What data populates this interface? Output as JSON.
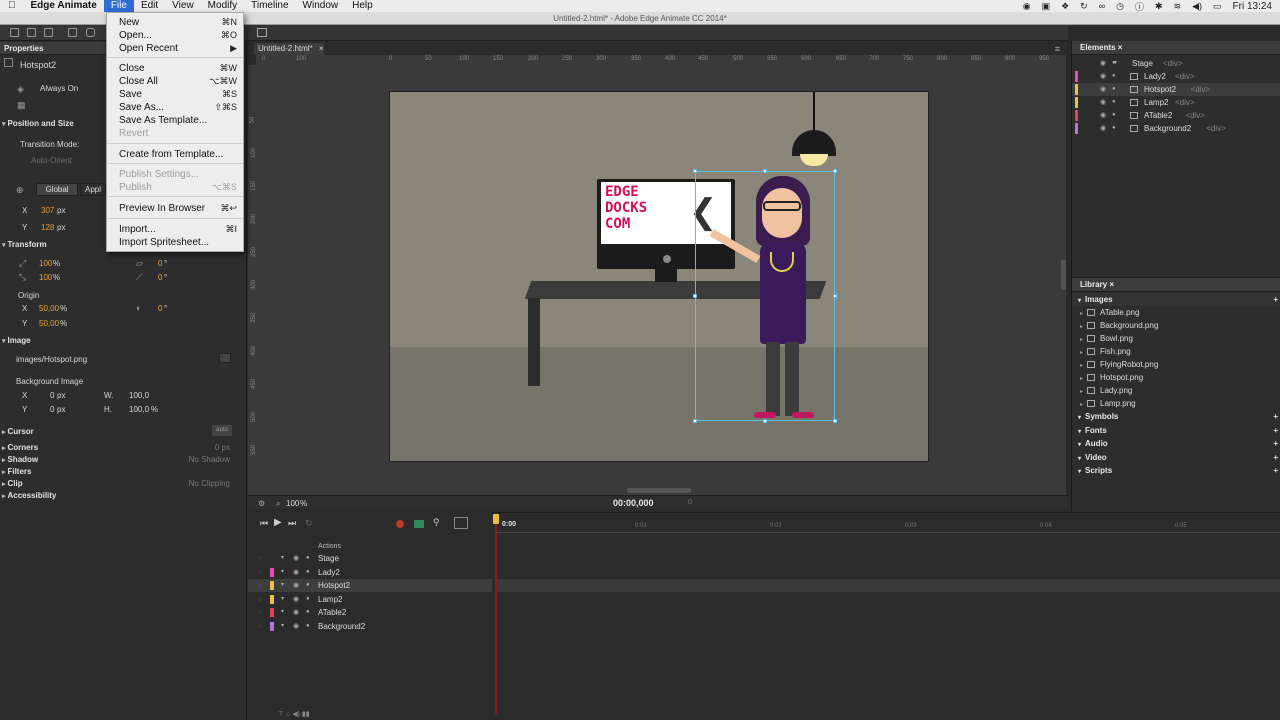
{
  "menubar": {
    "apple": "",
    "app": "Edge Animate",
    "items": [
      "File",
      "Edit",
      "View",
      "Modify",
      "Timeline",
      "Window",
      "Help"
    ],
    "clock": "Fri 13:24"
  },
  "window_title": "Untitled-2.html* - Adobe Edge Animate CC 2014*",
  "file_menu": {
    "items": [
      {
        "label": "New",
        "shortcut": "⌘N",
        "disabled": false
      },
      {
        "label": "Open...",
        "shortcut": "⌘O",
        "disabled": false
      },
      {
        "label": "Open Recent",
        "shortcut": "▶",
        "disabled": false
      },
      {
        "label": "Close",
        "shortcut": "⌘W",
        "disabled": false
      },
      {
        "label": "Close All",
        "shortcut": "⌥⌘W",
        "disabled": false
      },
      {
        "label": "Save",
        "shortcut": "⌘S",
        "disabled": false
      },
      {
        "label": "Save As...",
        "shortcut": "⇧⌘S",
        "disabled": false
      },
      {
        "label": "Save As Template...",
        "shortcut": "",
        "disabled": false
      },
      {
        "label": "Revert",
        "shortcut": "",
        "disabled": true
      },
      {
        "label": "Create from Template...",
        "shortcut": "",
        "disabled": false
      },
      {
        "label": "Publish Settings...",
        "shortcut": "",
        "disabled": true
      },
      {
        "label": "Publish",
        "shortcut": "⌥⌘S",
        "disabled": true
      },
      {
        "label": "Preview In Browser",
        "shortcut": "⌘↩",
        "disabled": false
      },
      {
        "label": "Import...",
        "shortcut": "⌘I",
        "disabled": false
      },
      {
        "label": "Import Spritesheet...",
        "shortcut": "",
        "disabled": false
      }
    ]
  },
  "properties": {
    "tab": "Properties",
    "element_name": "Hotspot2",
    "always_on": "Always On",
    "position_size": "Position and Size",
    "transition_mode": "Transition Mode:",
    "auto_orient": "Auto-Orient",
    "global": "Global",
    "applied": "Appl",
    "x_label": "X",
    "x_val": "307",
    "y_label": "Y",
    "y_val": "128",
    "px": "px",
    "transform": "Transform",
    "scale_x": "100",
    "scale_y": "100",
    "percent": "%",
    "skew_a": "0",
    "skew_b": "0",
    "deg": "°",
    "origin": "Origin",
    "origin_x": "50,00",
    "origin_y": "50,00",
    "rotate": "0",
    "image": "Image",
    "image_path": "images/Hotspot.png",
    "bg_image": "Background Image",
    "bg_x": "0",
    "bg_y": "0",
    "w_label": "W.",
    "h_label": "H.",
    "bg_w": "100,0",
    "bg_h": "100,0",
    "cursor": "Cursor",
    "cursor_val": "auto",
    "corners": "Corners",
    "corners_val": "0 px",
    "shadow": "Shadow",
    "shadow_val": "No Shadow",
    "filters": "Filters",
    "clip": "Clip",
    "clip_val": "No Clipping",
    "accessibility": "Accessibility"
  },
  "stage": {
    "tab": "Untitled-2.html*",
    "ruler_ticks": [
      "0",
      "100",
      "0",
      "50",
      "100",
      "150",
      "200",
      "250",
      "300",
      "350",
      "400",
      "450",
      "500",
      "550",
      "600",
      "650",
      "700",
      "750",
      "800",
      "850",
      "900",
      "950"
    ],
    "vruler_ticks": [
      "50",
      "100",
      "150",
      "200",
      "250",
      "300",
      "350",
      "400",
      "450",
      "500",
      "550"
    ],
    "zoom": "100",
    "timecode": "00:00,000",
    "frame": "0",
    "sign_text": [
      "EDGE",
      "DOCKS",
      "COM"
    ]
  },
  "elements": {
    "tab": "Elements",
    "rows": [
      {
        "name": "Stage",
        "tag": "<div>",
        "color": "",
        "indent": 0,
        "selected": false
      },
      {
        "name": "Lady2",
        "tag": "<div>",
        "color": "#e94cb4",
        "indent": 1,
        "selected": false
      },
      {
        "name": "Hotspot2",
        "tag": "<div>",
        "color": "#e4c54b",
        "indent": 1,
        "selected": true
      },
      {
        "name": "Lamp2",
        "tag": "<div>",
        "color": "#e4c54b",
        "indent": 1,
        "selected": false
      },
      {
        "name": "ATable2",
        "tag": "<div>",
        "color": "#e44060",
        "indent": 1,
        "selected": false
      },
      {
        "name": "Background2",
        "tag": "<div>",
        "color": "#b07ad8",
        "indent": 1,
        "selected": false
      }
    ]
  },
  "library": {
    "tab": "Library",
    "images_label": "Images",
    "images": [
      "ATable.png",
      "Background.png",
      "Bowl.png",
      "Fish.png",
      "FlyingRobot.png",
      "Hotspot.png",
      "Lady.png",
      "Lamp.png"
    ],
    "sections": [
      "Symbols",
      "Fonts",
      "Audio",
      "Video",
      "Scripts"
    ]
  },
  "timeline": {
    "actions_label": "Actions",
    "time_start": "0:00",
    "ticks": [
      "0:01",
      "0:02",
      "0:03",
      "0:04",
      "0:05"
    ],
    "rows": [
      {
        "name": "Stage",
        "color": "",
        "selected": false
      },
      {
        "name": "Lady2",
        "color": "#e94cb4",
        "selected": false
      },
      {
        "name": "Hotspot2",
        "color": "#e4c54b",
        "selected": true
      },
      {
        "name": "Lamp2",
        "color": "#e4c54b",
        "selected": false
      },
      {
        "name": "ATable2",
        "color": "#e44060",
        "selected": false
      },
      {
        "name": "Background2",
        "color": "#b07ad8",
        "selected": false
      }
    ]
  },
  "colors": {
    "accent": "#2f6bd6",
    "selection": "#5bc0e8",
    "value_orange": "#e5a23a",
    "brand_pink": "#d0105a"
  }
}
